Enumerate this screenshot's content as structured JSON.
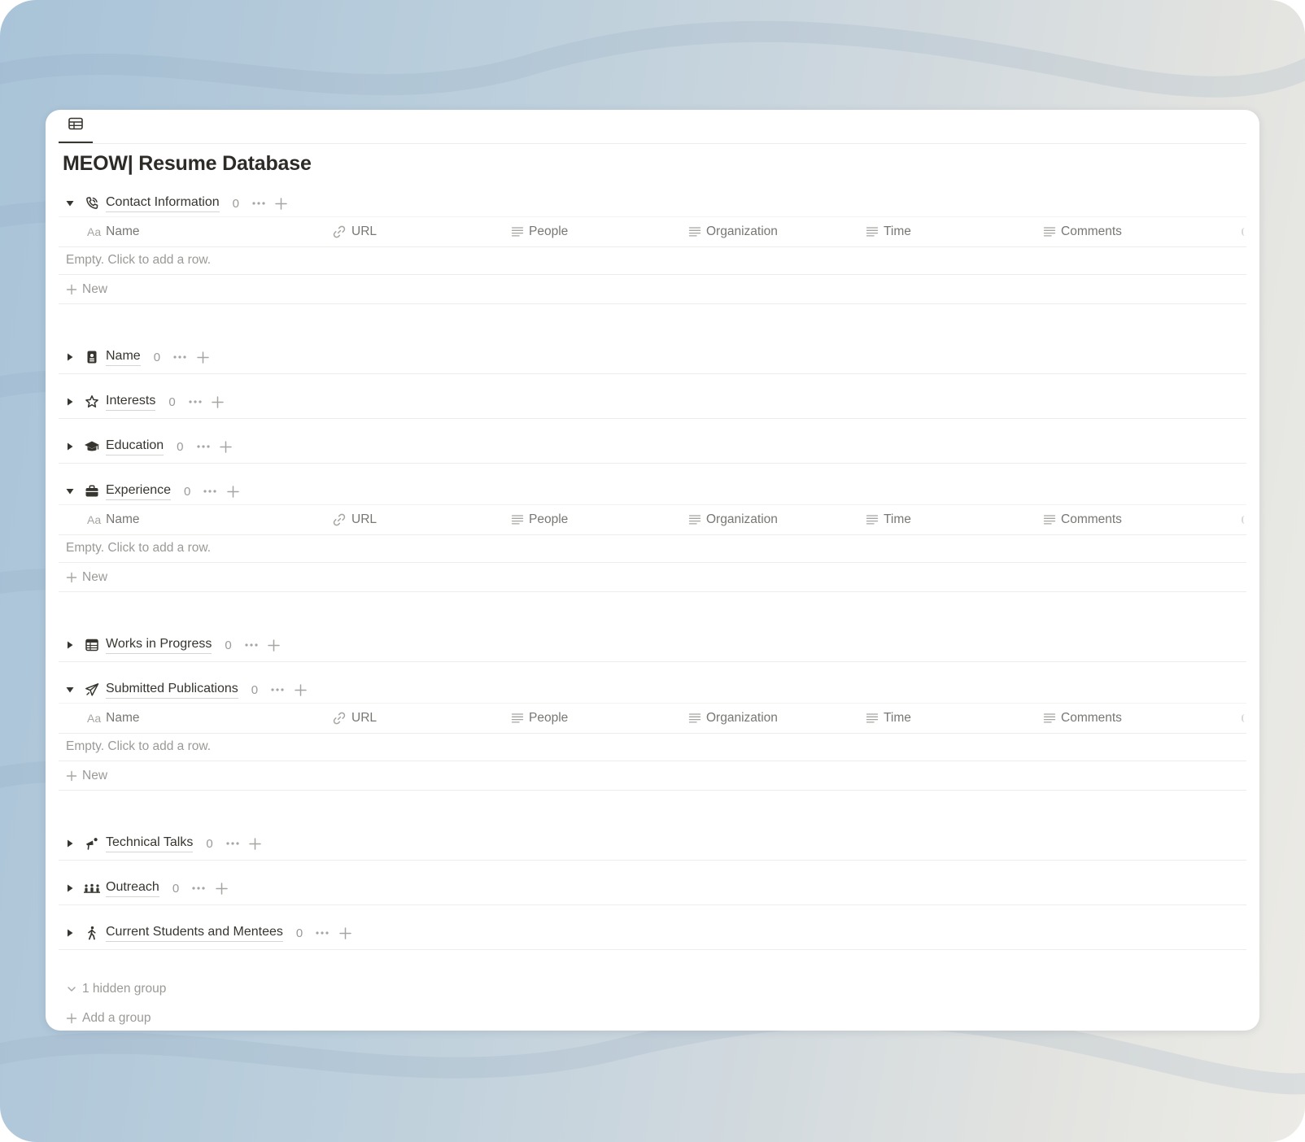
{
  "page": {
    "title": "MEOW| Resume Database",
    "view_tab_icon": "table-icon"
  },
  "columns": [
    {
      "label": "Name",
      "icon": "aa-text-icon",
      "prefix": "Aa"
    },
    {
      "label": "URL",
      "icon": "link-icon"
    },
    {
      "label": "People",
      "icon": "text-lines-icon"
    },
    {
      "label": "Organization",
      "icon": "text-lines-icon"
    },
    {
      "label": "Time",
      "icon": "text-lines-icon"
    },
    {
      "label": "Comments",
      "icon": "text-lines-icon"
    }
  ],
  "table": {
    "empty_text": "Empty. Click to add a row.",
    "new_label": "New"
  },
  "groups": [
    {
      "name": "Contact Information",
      "count": "0",
      "icon": "phone-icon",
      "expanded": true
    },
    {
      "name": "Name",
      "count": "0",
      "icon": "id-badge-icon",
      "expanded": false
    },
    {
      "name": "Interests",
      "count": "0",
      "icon": "star-icon",
      "expanded": false
    },
    {
      "name": "Education",
      "count": "0",
      "icon": "graduation-cap-icon",
      "expanded": false
    },
    {
      "name": "Experience",
      "count": "0",
      "icon": "briefcase-icon",
      "expanded": true
    },
    {
      "name": "Works in Progress",
      "count": "0",
      "icon": "calendar-table-icon",
      "expanded": false
    },
    {
      "name": "Submitted Publications",
      "count": "0",
      "icon": "paper-plane-icon",
      "expanded": true
    },
    {
      "name": "Technical Talks",
      "count": "0",
      "icon": "megaphone-icon",
      "expanded": false
    },
    {
      "name": "Outreach",
      "count": "0",
      "icon": "people-group-icon",
      "expanded": false
    },
    {
      "name": "Current Students and Mentees",
      "count": "0",
      "icon": "person-walking-icon",
      "expanded": false
    }
  ],
  "footer": {
    "hidden_groups": "1 hidden group",
    "add_group": "Add a group"
  }
}
